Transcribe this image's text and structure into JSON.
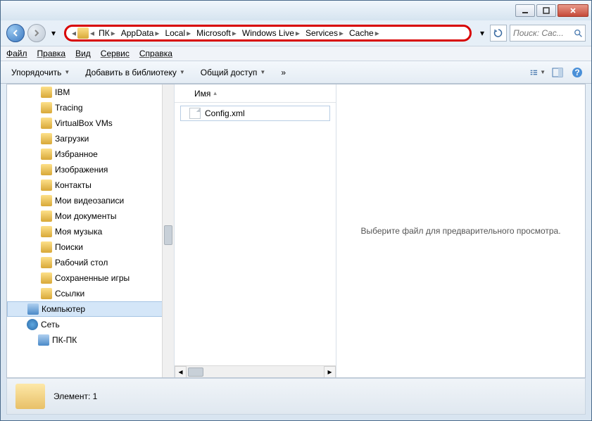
{
  "breadcrumb": [
    "ПК",
    "AppData",
    "Local",
    "Microsoft",
    "Windows Live",
    "Services",
    "Cache"
  ],
  "search": {
    "placeholder": "Поиск: Cac..."
  },
  "menu": {
    "file": "Файл",
    "edit": "Правка",
    "view": "Вид",
    "tools": "Сервис",
    "help": "Справка"
  },
  "toolbar": {
    "organize": "Упорядочить",
    "library": "Добавить в библиотеку",
    "share": "Общий доступ"
  },
  "tree": [
    {
      "label": "IBM",
      "icon": "folder"
    },
    {
      "label": "Tracing",
      "icon": "folder"
    },
    {
      "label": "VirtualBox VMs",
      "icon": "folder"
    },
    {
      "label": "Загрузки",
      "icon": "folder"
    },
    {
      "label": "Избранное",
      "icon": "folder"
    },
    {
      "label": "Изображения",
      "icon": "folder"
    },
    {
      "label": "Контакты",
      "icon": "folder"
    },
    {
      "label": "Мои видеозаписи",
      "icon": "folder"
    },
    {
      "label": "Мои документы",
      "icon": "folder"
    },
    {
      "label": "Моя музыка",
      "icon": "folder"
    },
    {
      "label": "Поиски",
      "icon": "folder"
    },
    {
      "label": "Рабочий стол",
      "icon": "folder"
    },
    {
      "label": "Сохраненные игры",
      "icon": "folder"
    },
    {
      "label": "Ссылки",
      "icon": "folder"
    }
  ],
  "tree_roots": {
    "computer": "Компьютер",
    "network": "Сеть",
    "network_child": "ПК-ПК"
  },
  "filelist": {
    "col_name": "Имя",
    "items": [
      "Config.xml"
    ]
  },
  "preview": {
    "text": "Выберите файл для предварительного просмотра."
  },
  "status": {
    "text": "Элемент: 1"
  }
}
